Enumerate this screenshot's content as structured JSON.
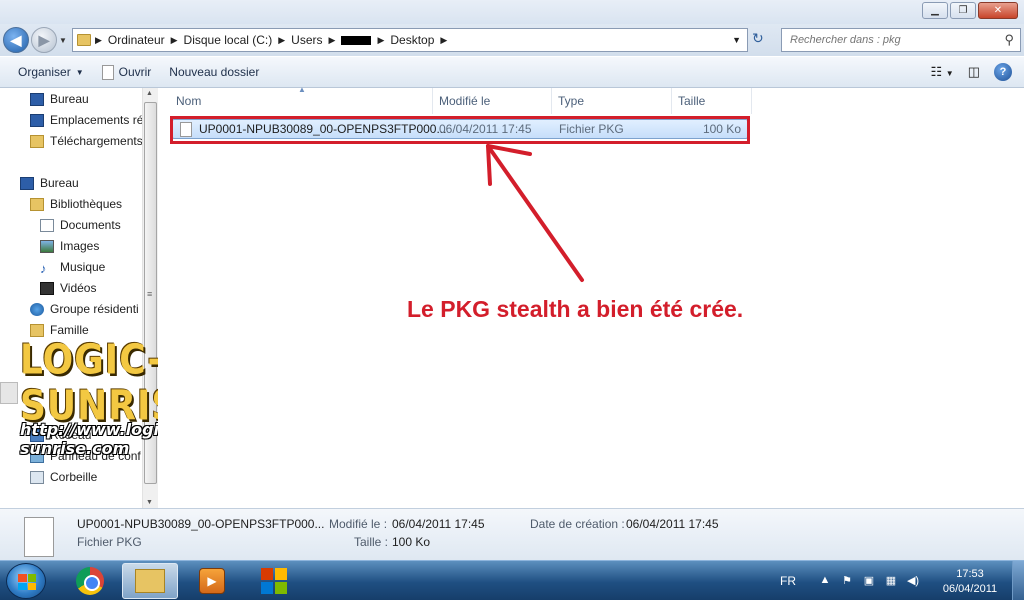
{
  "window": {
    "buttons": {
      "minimize": "▁",
      "maximize": "❐",
      "close": "✕"
    }
  },
  "address": {
    "crumbs": [
      "Ordinateur",
      "Disque local (C:)",
      "Users",
      "Desktop"
    ],
    "search_placeholder": "Rechercher dans : pkg"
  },
  "toolbar": {
    "organize": "Organiser",
    "open": "Ouvrir",
    "new_folder": "Nouveau dossier"
  },
  "nav": {
    "favorites": [
      "Bureau",
      "Emplacements ré",
      "Téléchargements"
    ],
    "desktop": "Bureau",
    "libraries": "Bibliothèques",
    "library_items": [
      "Documents",
      "Images",
      "Musique",
      "Vidéos"
    ],
    "homegroup": "Groupe résidenti",
    "user": "Famille",
    "network": "Réseau",
    "control_panel": "Panneau de conf",
    "recycle_bin": "Corbeille"
  },
  "logo": {
    "main": "LOGIC-SUNRISE",
    "url": "http://www.logic-sunrise.com"
  },
  "columns": {
    "name": "Nom",
    "modified": "Modifié le",
    "type": "Type",
    "size": "Taille"
  },
  "file": {
    "name": "UP0001-NPUB30089_00-OPENPS3FTP000...",
    "modified": "06/04/2011 17:45",
    "type": "Fichier PKG",
    "size": "100 Ko"
  },
  "annotation": "Le PKG stealth a bien été crée.",
  "details": {
    "name": "UP0001-NPUB30089_00-OPENPS3FTP000...",
    "type": "Fichier PKG",
    "modified_label": "Modifié le :",
    "modified_value": "06/04/2011 17:45",
    "size_label": "Taille :",
    "size_value": "100 Ko",
    "created_label": "Date de création :",
    "created_value": "06/04/2011 17:45"
  },
  "taskbar": {
    "language": "FR",
    "time": "17:53",
    "date": "06/04/2011"
  },
  "colors": {
    "annotation_red": "#d31e2b",
    "logo_gold": "#f3c842",
    "taskbar_blue": "#1f4f82"
  }
}
